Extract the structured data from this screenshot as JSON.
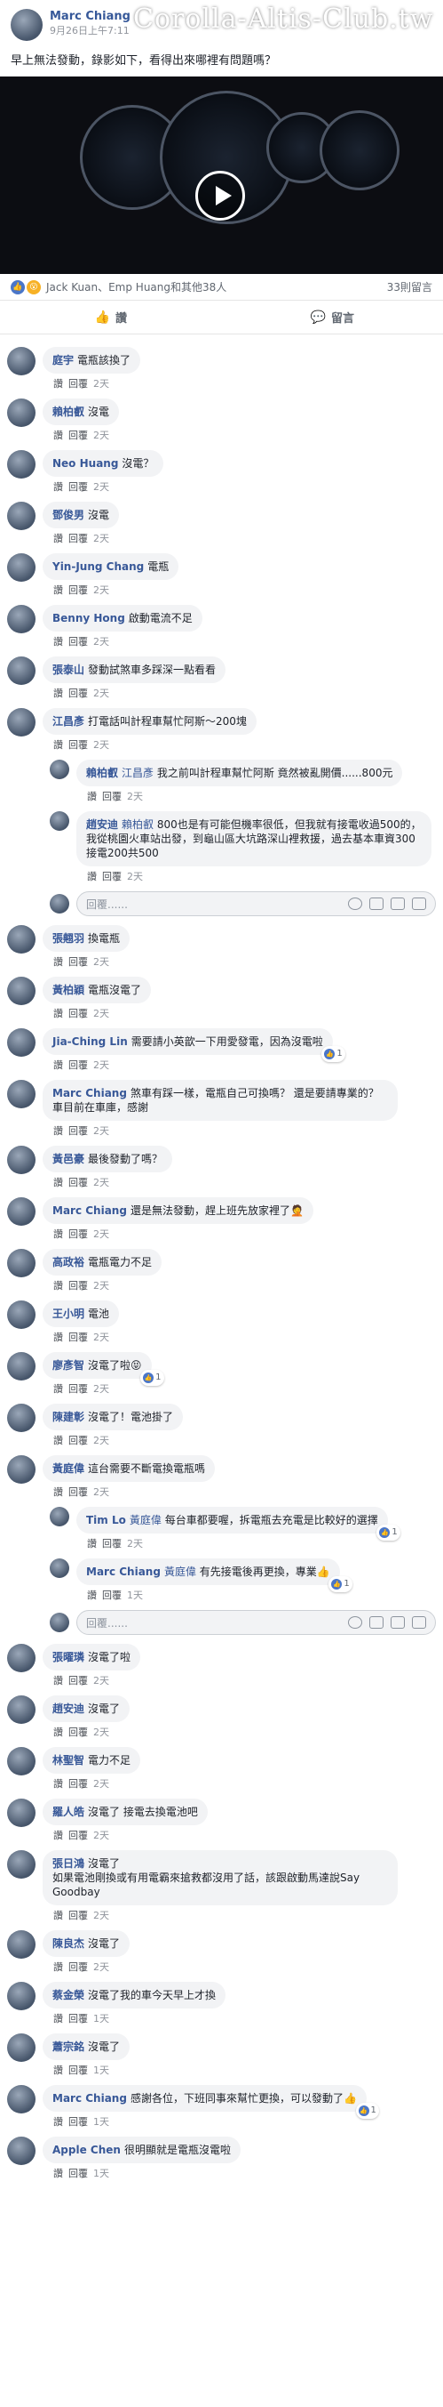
{
  "watermark": "Corolla-Altis-Club.tw",
  "post": {
    "author": "Marc Chiang",
    "time": "9月26日上午7:11",
    "text": "早上無法發動，錄影如下，看得出來哪裡有問題嗎？"
  },
  "reactions": {
    "names": "Jack Kuan、Emp Huang和其他38人",
    "comment_count": "33則留言"
  },
  "actions": {
    "like": "讚",
    "comment": "留言"
  },
  "labels": {
    "like": "讚",
    "reply": "回覆",
    "placeholder": "回覆......"
  },
  "comments": [
    {
      "author": "庭宇",
      "text": "電瓶該換了",
      "time": "2天"
    },
    {
      "author": "賴柏叡",
      "text": "沒電",
      "time": "2天"
    },
    {
      "author": "Neo Huang",
      "text": "沒電？",
      "time": "2天"
    },
    {
      "author": "鄧俊男",
      "text": "沒電",
      "time": "2天"
    },
    {
      "author": "Yin-Jung Chang",
      "text": "電瓶",
      "time": "2天"
    },
    {
      "author": "Benny Hong",
      "text": "啟動電流不足",
      "time": "2天"
    },
    {
      "author": "張泰山",
      "text": "發動試煞車多踩深一點看看",
      "time": "2天"
    },
    {
      "author": "江昌彥",
      "text": "打電話叫計程車幫忙阿斯～200塊",
      "time": "2天"
    }
  ],
  "replies_1": [
    {
      "author": "賴柏叡",
      "tag": "江昌彥",
      "text": "我之前叫計程車幫忙阿斯 竟然被亂開價......800元",
      "time": "2天"
    },
    {
      "author": "趙安迪",
      "tag": "賴柏叡",
      "text": "800也是有可能但機率很低，但我就有接電收過500的，我從桃園火車站出發，到龜山區大坑路深山裡救援，過去基本車資300接電200共500",
      "time": "2天"
    }
  ],
  "comments_2": [
    {
      "author": "張翹羽",
      "text": "換電瓶",
      "time": "2天",
      "likes": ""
    },
    {
      "author": "黃柏穎",
      "text": "電瓶沒電了",
      "time": "2天",
      "likes": ""
    },
    {
      "author": "Jia-Ching Lin",
      "text": "需要請小英歆一下用愛發電，因為沒電啦",
      "time": "2天",
      "likes": "1"
    },
    {
      "author": "Marc Chiang",
      "text": "煞車有踩一樣，電瓶自己可換嗎？ 還是要請專業的？ 車目前在車庫，感謝",
      "time": "2天",
      "likes": ""
    },
    {
      "author": "黃邑豪",
      "text": "最後發動了嗎？",
      "time": "2天",
      "likes": ""
    },
    {
      "author": "Marc Chiang",
      "text": "還是無法發動，趕上班先放家裡了🤦",
      "time": "2天",
      "likes": ""
    },
    {
      "author": "高政裕",
      "text": "電瓶電力不足",
      "time": "2天",
      "likes": ""
    },
    {
      "author": "王小明",
      "text": "電池",
      "time": "2天",
      "likes": ""
    },
    {
      "author": "廖彥智",
      "text": "沒電了啦😝",
      "time": "2天",
      "likes": "1"
    },
    {
      "author": "陳建彰",
      "text": "沒電了！電池掛了",
      "time": "2天",
      "likes": ""
    },
    {
      "author": "黃庭偉",
      "text": "這台需要不斷電換電瓶嗎",
      "time": "2天",
      "likes": ""
    }
  ],
  "replies_2": [
    {
      "author": "Tim Lo",
      "tag": "黃庭偉",
      "text": "每台車都要喔，拆電瓶去充電是比較好的選擇",
      "time": "2天",
      "likes": "1"
    },
    {
      "author": "Marc Chiang",
      "tag": "黃庭偉",
      "text": "有先接電後再更換，專業👍",
      "time": "1天",
      "likes": "1"
    }
  ],
  "comments_3": [
    {
      "author": "張曜璘",
      "text": "沒電了啦",
      "time": "2天",
      "likes": ""
    },
    {
      "author": "趙安迪",
      "text": "沒電了",
      "time": "2天",
      "likes": ""
    },
    {
      "author": "林聖智",
      "text": "電力不足",
      "time": "2天",
      "likes": ""
    },
    {
      "author": "羅人皓",
      "text": "沒電了 接電去換電池吧",
      "time": "2天",
      "likes": ""
    },
    {
      "author": "張日鴻",
      "text": "沒電了\n如果電池剛換或有用電霸來搶救都沒用了話，該跟啟動馬達說Say Goodbay",
      "time": "2天",
      "likes": ""
    },
    {
      "author": "陳良杰",
      "text": "沒電了",
      "time": "2天",
      "likes": ""
    },
    {
      "author": "蔡金榮",
      "text": "沒電了我的車今天早上才換",
      "time": "1天",
      "likes": ""
    },
    {
      "author": "蕭宗銘",
      "text": "沒電了",
      "time": "1天",
      "likes": ""
    },
    {
      "author": "Marc Chiang",
      "text": "感謝各位，下班同事來幫忙更換，可以發動了👍",
      "time": "1天",
      "likes": "1"
    },
    {
      "author": "Apple Chen",
      "text": "很明顯就是電瓶沒電啦",
      "time": "1天",
      "likes": ""
    }
  ]
}
